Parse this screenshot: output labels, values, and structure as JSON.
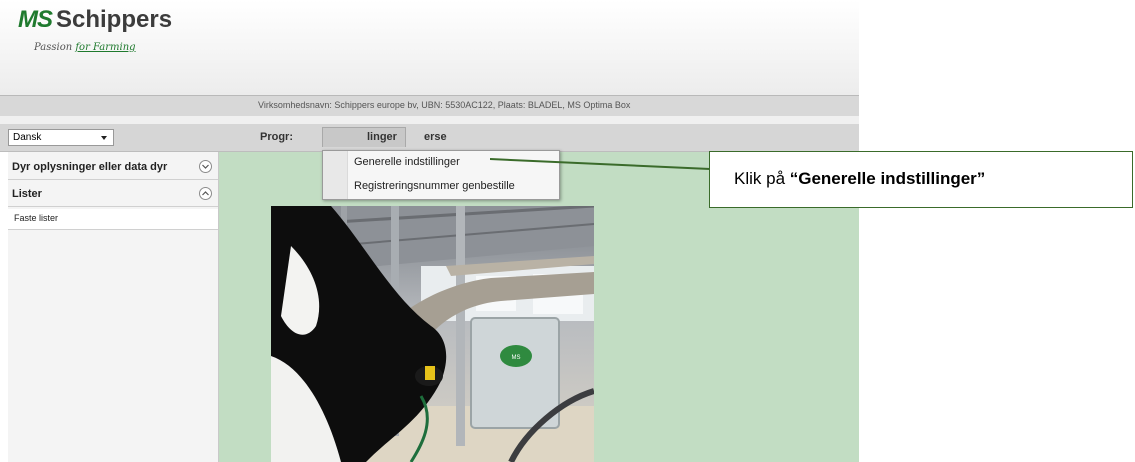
{
  "brand": {
    "logo_mark": "MS",
    "logo_name": "Schippers",
    "tagline_pre": "Passion ",
    "tagline_mid": "for Farming",
    "color": "#1f7a2e"
  },
  "infobar": {
    "text": "Virksomhedsnavn: Schippers europe bv, UBN: 5530AC122, Plaats: BLADEL, MS Optima Box"
  },
  "toolbar": {
    "language": "Dansk",
    "menu": [
      {
        "label": "Progr:"
      },
      {
        "label": "linger"
      },
      {
        "label": "erse"
      }
    ]
  },
  "dropdown": {
    "items": [
      {
        "label": "Generelle indstillinger"
      },
      {
        "label": "Registreringsnummer genbestille"
      }
    ]
  },
  "sidebar": {
    "sections": [
      {
        "label": "Dyr oplysninger eller data dyr",
        "icon": "chevron-down-icon"
      },
      {
        "label": "Lister",
        "icon": "chevron-up-icon"
      }
    ],
    "subitems": [
      {
        "label": "Faste lister"
      }
    ]
  },
  "callout": {
    "prefix": "Klik på ",
    "emphasis": "“Generelle indstillinger”"
  },
  "colors": {
    "content_bg": "#c2ddc3",
    "callout_border": "#3a6b2a"
  }
}
